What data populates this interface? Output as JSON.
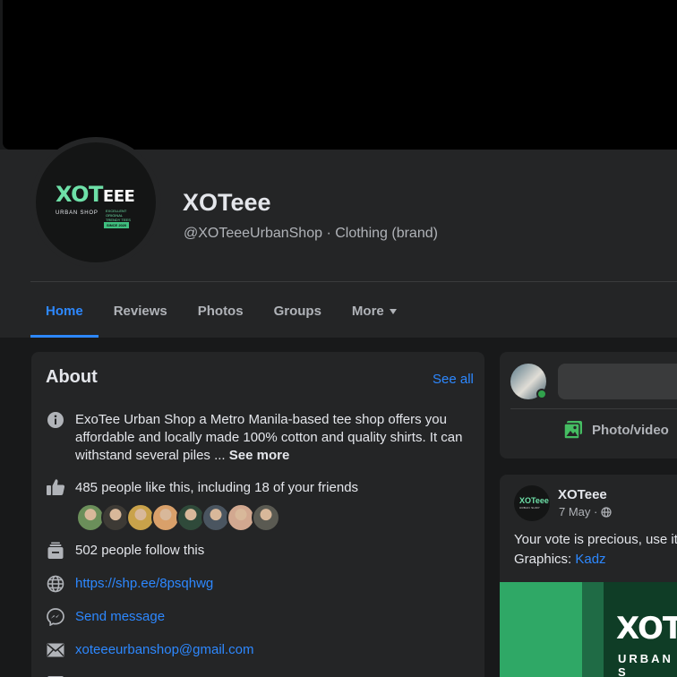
{
  "page": {
    "name": "XOTeee",
    "handle_line": "@XOTeeeUrbanShop · Clothing (brand)"
  },
  "logo": {
    "main": "XOT",
    "main_small": "EEE",
    "sub": "URBAN SHOP",
    "tag": "EXCELLENT ORIGINAL TRENDY TEES",
    "since": "SINCE 2020"
  },
  "tabs": [
    {
      "label": "Home",
      "active": true
    },
    {
      "label": "Reviews"
    },
    {
      "label": "Photos"
    },
    {
      "label": "Groups"
    },
    {
      "label": "More"
    }
  ],
  "about": {
    "title": "About",
    "see_all": "See all",
    "description": "ExoTee Urban Shop a Metro Manila-based tee shop offers you affordable and locally made 100% cotton and quality shirts. It can withstand several piles ... ",
    "see_more": "See more",
    "likes": "485 people like this, including 18 of your friends",
    "follows": "502 people follow this",
    "website": "https://shp.ee/8psqhwg",
    "message": "Send message",
    "email": "xoteeeurbanshop@gmail.com"
  },
  "composer": {
    "photo_label": "Photo/video"
  },
  "post": {
    "author": "XOTeee",
    "date": "7 May · ",
    "text_line1": "Your vote is precious, use it w",
    "graphics_label": "Graphics: ",
    "graphics_link": "Kadz",
    "image_title": "XOT",
    "image_sub": "URBAN S",
    "avatar_text": "XOTeee",
    "avatar_sub": "URBAN SHOP"
  },
  "friend_colors": [
    "#6b8f5a",
    "#3d3a35",
    "#c9a24a",
    "#d9a06a",
    "#2f4a3a",
    "#4a5560",
    "#d2a890",
    "#5a5a52"
  ],
  "colors": {
    "accent": "#2d88ff",
    "brand_green": "#6ee0a8",
    "background": "#18191a",
    "card": "#242526"
  }
}
